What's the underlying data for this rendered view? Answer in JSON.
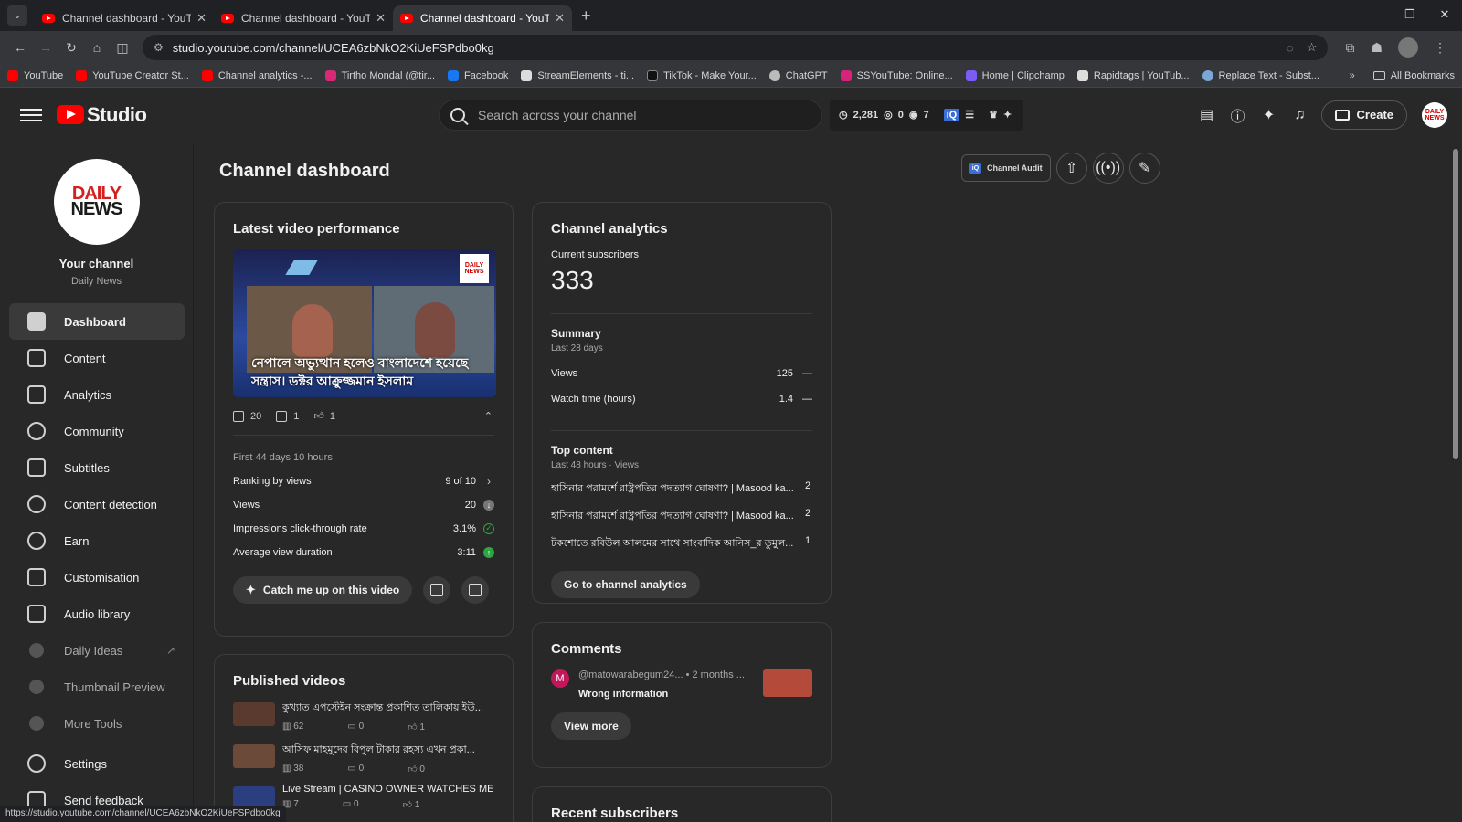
{
  "browser": {
    "tabs": [
      {
        "title": "Channel dashboard - YouTube"
      },
      {
        "title": "Channel dashboard - YouTube"
      },
      {
        "title": "Channel dashboard - YouTube"
      }
    ],
    "url": "studio.youtube.com/channel/UCEA6zbNkO2KiUeFSPdbo0kg",
    "bookmarks": [
      {
        "label": "YouTube",
        "color": "#ff0000"
      },
      {
        "label": "YouTube Creator St...",
        "color": "#ff0000"
      },
      {
        "label": "Channel analytics -...",
        "color": "#ff0000"
      },
      {
        "label": "Tirtho Mondal (@tir...",
        "color": "#d62976"
      },
      {
        "label": "Facebook",
        "color": "#1877f2"
      },
      {
        "label": "StreamElements - ti...",
        "color": "#dddddd"
      },
      {
        "label": "TikTok - Make Your...",
        "color": "#111111"
      },
      {
        "label": "ChatGPT",
        "color": "#bbbbbb"
      },
      {
        "label": "SSYouTube: Online...",
        "color": "#d6247a"
      },
      {
        "label": "Home | Clipchamp",
        "color": "#7b5cf5"
      },
      {
        "label": "Rapidtags | YouTub...",
        "color": "#dddddd"
      },
      {
        "label": "Replace Text - Subst...",
        "color": "#7aa7d6"
      }
    ],
    "all_bookmarks": "All Bookmarks",
    "status_url": "https://studio.youtube.com/channel/UCEA6zbNkO2KiUeFSPdbo0kg"
  },
  "header": {
    "logo_word": "Studio",
    "search_placeholder": "Search across your channel",
    "stats": {
      "views": "2,281",
      "comments": "0",
      "watch": "7"
    },
    "create_label": "Create",
    "avatar_text": "DAILY NEWS"
  },
  "sidebar": {
    "logo_line1": "DAILY",
    "logo_line2": "NEWS",
    "channel_title": "Your channel",
    "channel_name": "Daily News",
    "items": [
      {
        "label": "Dashboard"
      },
      {
        "label": "Content"
      },
      {
        "label": "Analytics"
      },
      {
        "label": "Community"
      },
      {
        "label": "Subtitles"
      },
      {
        "label": "Content detection"
      },
      {
        "label": "Earn"
      },
      {
        "label": "Customisation"
      },
      {
        "label": "Audio library"
      },
      {
        "label": "Daily Ideas"
      },
      {
        "label": "Thumbnail Preview"
      },
      {
        "label": "More Tools"
      },
      {
        "label": "Settings"
      },
      {
        "label": "Send feedback"
      }
    ]
  },
  "main": {
    "page_title": "Channel dashboard",
    "audit_label": "Channel Audit",
    "latest": {
      "title": "Latest video performance",
      "thumb_caption": "নেপালে অভ্যুত্থান হলেও বাংলাদেশে হয়েছে সন্ত্রাস। ডক্টর আক্রুজ্জমান ইসলাম",
      "thumb_badge": "DAILY NEWS",
      "views": "20",
      "comments": "1",
      "likes": "1",
      "period": "First 44 days 10 hours",
      "rows": [
        {
          "label": "Ranking by views",
          "value": "9 of 10"
        },
        {
          "label": "Views",
          "value": "20"
        },
        {
          "label": "Impressions click-through rate",
          "value": "3.1%"
        },
        {
          "label": "Average view duration",
          "value": "3:11"
        }
      ],
      "catch_label": "Catch me up on this video"
    },
    "published": {
      "title": "Published videos",
      "videos": [
        {
          "title": "কুখ্যাত এপস্টেইন সংক্রান্ত প্রকাশিত তালিকায় ইউ...",
          "views": "62",
          "comments": "0",
          "likes": "1"
        },
        {
          "title": "আসিফ মাহমুদের বিপুল টাকার রহস্য এখন প্রকা...",
          "views": "38",
          "comments": "0",
          "likes": "0"
        },
        {
          "title": "Live Stream | CASINO OWNER WATCHES ME B...",
          "views": "7",
          "comments": "0",
          "likes": "1"
        }
      ]
    },
    "analytics": {
      "title": "Channel analytics",
      "subs_label": "Current subscribers",
      "subs_value": "333",
      "summary_title": "Summary",
      "summary_period": "Last 28 days",
      "summary_rows": [
        {
          "label": "Views",
          "value": "125",
          "trend": "—"
        },
        {
          "label": "Watch time (hours)",
          "value": "1.4",
          "trend": "—"
        }
      ],
      "top_title": "Top content",
      "top_period": "Last 48 hours · Views",
      "top_items": [
        {
          "title": "হাসিনার পরামর্শে রাষ্ট্রপতির পদত্যাগ ঘোষণা? | Masood ka...",
          "views": "2"
        },
        {
          "title": "হাসিনার পরামর্শে রাষ্ট্রপতির পদত্যাগ ঘোষণা? | Masood ka...",
          "views": "2"
        },
        {
          "title": "টকশোতে রবিউল আলমের সাথে সাংবাদিক আনিস_র তুমুল...",
          "views": "1"
        }
      ],
      "go_label": "Go to channel analytics"
    },
    "comments": {
      "title": "Comments",
      "author_initial": "M",
      "author": "@matowarabegum24...",
      "time": "• 2 months ...",
      "text": "Wrong information",
      "view_more": "View more"
    },
    "recent_subs_title": "Recent subscribers"
  }
}
